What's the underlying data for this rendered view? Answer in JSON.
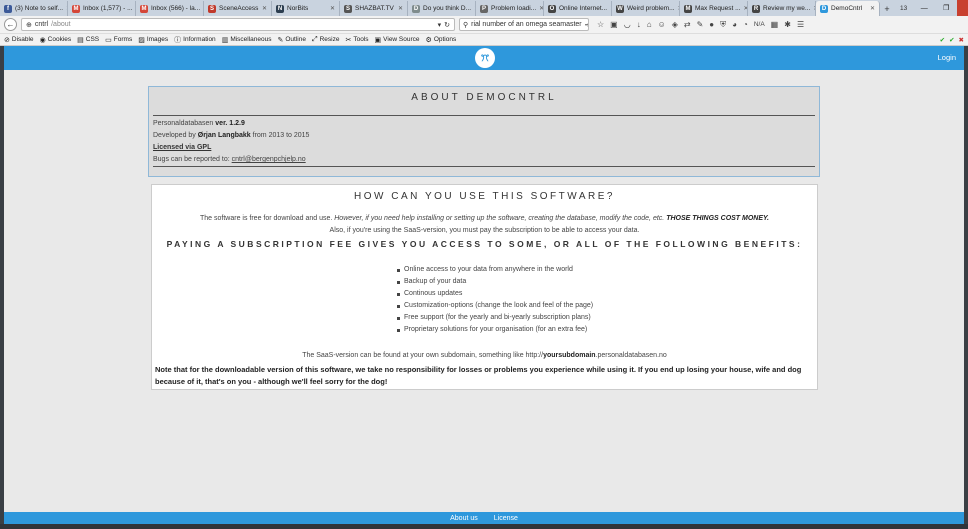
{
  "browser": {
    "tabs": [
      {
        "label": "(3) Note to self...",
        "color": "#3b5998",
        "glyph": "f"
      },
      {
        "label": "Inbox (1,577) - ...",
        "color": "#d44638",
        "glyph": "M"
      },
      {
        "label": "Inbox (566) - la...",
        "color": "#d44638",
        "glyph": "M"
      },
      {
        "label": "SceneAccess",
        "color": "#c0392b",
        "glyph": "S"
      },
      {
        "label": "NorBits",
        "color": "#2c3e50",
        "glyph": "N"
      },
      {
        "label": "SHAZBAT.TV",
        "color": "#555555",
        "glyph": "S"
      },
      {
        "label": "Do you think D...",
        "color": "#7f8c8d",
        "glyph": "D"
      },
      {
        "label": "Problem loadi...",
        "color": "#666666",
        "glyph": "P"
      },
      {
        "label": "Online Internet...",
        "color": "#444444",
        "glyph": "O"
      },
      {
        "label": "Weird problem...",
        "color": "#444444",
        "glyph": "W"
      },
      {
        "label": "Max Request ...",
        "color": "#444444",
        "glyph": "M"
      },
      {
        "label": "Review my we...",
        "color": "#444444",
        "glyph": "R"
      },
      {
        "label": "DemoCntrl",
        "color": "#2e98dc",
        "glyph": "D",
        "active": true
      }
    ],
    "tab_count": "13",
    "url_host": "cntrl",
    "url_path": "/about",
    "search_value": "rial number of an omega seamaster",
    "na_label": "N/A",
    "devbar": [
      "Disable",
      "Cookies",
      "CSS",
      "Forms",
      "Images",
      "Information",
      "Miscellaneous",
      "Outline",
      "Resize",
      "Tools",
      "View Source",
      "Options"
    ]
  },
  "header": {
    "login": "Login"
  },
  "about": {
    "title": "ABOUT DEMOCNTRL",
    "product": "Personaldatabasen",
    "version_label": "ver. 1.2.9",
    "developed_prefix": "Developed by",
    "developer": "Ørjan Langbakk",
    "developed_suffix": "from 2013 to 2015",
    "license": "Licensed via GPL",
    "bugs_prefix": "Bugs can be reported to:",
    "bugs_email": "cntrl@bergenpchjelp.no"
  },
  "use": {
    "title": "HOW CAN YOU USE THIS SOFTWARE?",
    "free_plain": "The software is free for download and use.",
    "free_italic": "However, if you need help installing or setting up the software, creating the database, modify the code, etc.",
    "free_caps": "THOSE THINGS COST MONEY.",
    "saas_line": "Also, if you're using the SaaS-version, you must pay the subscription to be able to access your data.",
    "benefits_title": "PAYING A SUBSCRIPTION FEE GIVES YOU ACCESS TO SOME, OR ALL OF THE FOLLOWING BENEFITS:",
    "benefits": [
      "Online access to your data from anywhere in the world",
      "Backup of your data",
      "Continous updates",
      "Customization-options (change the look and feel of the page)",
      "Free support (for the yearly and bi-yearly subscription plans)",
      "Proprietary solutions for your organisation (for an extra fee)"
    ],
    "found_prefix": "The SaaS-version can be found at your own subdomain, something like http://",
    "found_sub": "yoursubdomain",
    "found_suffix": ".personaldatabasen.no",
    "note": "Note that for the downloadable version of this software, we take no responsibility for losses or problems you experience while using it. If you end up losing your house, wife and dog because of it, that's on you - although we'll feel sorry for the dog!"
  },
  "footer": {
    "about": "About us",
    "license": "License"
  }
}
